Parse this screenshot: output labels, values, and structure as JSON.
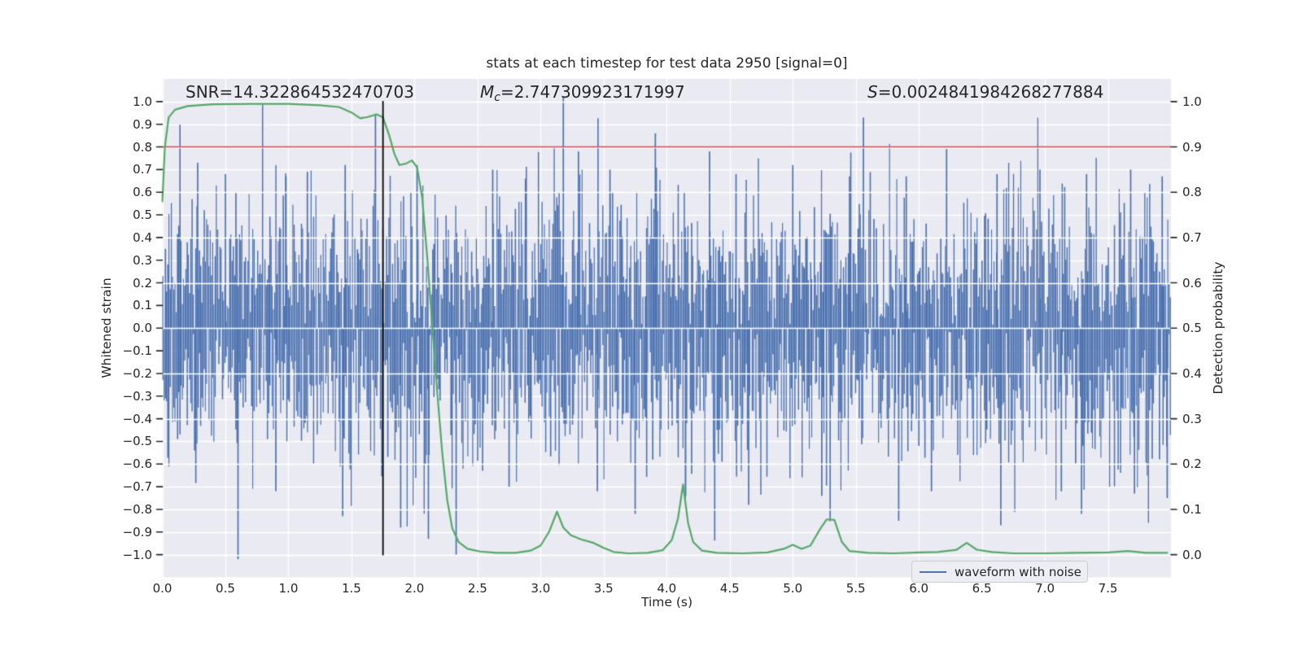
{
  "title": "stats at each timestep for test data 2950 [signal=0]",
  "annotations": {
    "snr": "SNR=14.322864532470703",
    "mc_var": "M",
    "mc_sub": "c",
    "mc_rest": "=2.747309923171997",
    "s_var": "S",
    "s_rest": "=0.0024841984268277884"
  },
  "axis_labels": {
    "x": "Time (s)",
    "y_left": "Whitened strain",
    "y_right": "Detection probability"
  },
  "ticks": {
    "x": [
      "0.0",
      "0.5",
      "1.0",
      "1.5",
      "2.0",
      "2.5",
      "3.0",
      "3.5",
      "4.0",
      "4.5",
      "5.0",
      "5.5",
      "6.0",
      "6.5",
      "7.0",
      "7.5"
    ],
    "left": [
      "1.0",
      "0.9",
      "0.8",
      "0.7",
      "0.6",
      "0.5",
      "0.4",
      "0.3",
      "0.2",
      "0.1",
      "0.0",
      "−0.1",
      "−0.2",
      "−0.3",
      "−0.4",
      "−0.5",
      "−0.6",
      "−0.7",
      "−0.8",
      "−0.9",
      "−1.0"
    ],
    "right": [
      "1.0",
      "0.9",
      "0.8",
      "0.7",
      "0.6",
      "0.5",
      "0.4",
      "0.3",
      "0.2",
      "0.1",
      "0.0"
    ]
  },
  "legend": {
    "items": [
      {
        "label": "waveform with noise",
        "color": "#4C72B0"
      }
    ]
  },
  "colors": {
    "figure_bg": "#ffffff",
    "plot_bg": "#eaeaf2",
    "grid": "#ffffff",
    "waveform": "#4C72B0",
    "detection": "#55A868",
    "threshold": "#C44E52",
    "event_line": "#000000",
    "text": "#262626",
    "tick": "#262626"
  },
  "chart_data": {
    "type": "line",
    "title": "stats at each timestep for test data 2950 [signal=0]",
    "xlabel": "Time (s)",
    "ylabel_left": "Whitened strain",
    "ylabel_right": "Detection probability",
    "xlim": [
      0,
      8
    ],
    "ylim_left": [
      -1.1,
      1.1
    ],
    "ylim_right": [
      -0.05,
      1.05
    ],
    "grid": true,
    "legend_position": "lower right",
    "stats": {
      "SNR": 14.322864532470703,
      "Mc": 2.747309923171997,
      "S": 0.0024841984268277884,
      "signal": 0
    },
    "threshold_line": {
      "axis": "right",
      "value": 0.9
    },
    "event_line": {
      "axis": "x",
      "value": 1.75,
      "span_left_axis": [
        -1.0,
        1.0
      ]
    },
    "detection_curve": {
      "name": "detection probability",
      "axis": "right",
      "color_key": "detection",
      "points": [
        [
          0.0,
          0.78
        ],
        [
          0.02,
          0.9
        ],
        [
          0.05,
          0.965
        ],
        [
          0.1,
          0.982
        ],
        [
          0.2,
          0.99
        ],
        [
          0.4,
          0.994
        ],
        [
          0.7,
          0.995
        ],
        [
          1.0,
          0.995
        ],
        [
          1.25,
          0.992
        ],
        [
          1.4,
          0.988
        ],
        [
          1.5,
          0.976
        ],
        [
          1.57,
          0.963
        ],
        [
          1.63,
          0.966
        ],
        [
          1.7,
          0.972
        ],
        [
          1.75,
          0.965
        ],
        [
          1.8,
          0.925
        ],
        [
          1.84,
          0.885
        ],
        [
          1.88,
          0.86
        ],
        [
          1.93,
          0.863
        ],
        [
          1.98,
          0.87
        ],
        [
          2.02,
          0.855
        ],
        [
          2.06,
          0.79
        ],
        [
          2.1,
          0.66
        ],
        [
          2.14,
          0.51
        ],
        [
          2.18,
          0.36
        ],
        [
          2.22,
          0.225
        ],
        [
          2.26,
          0.12
        ],
        [
          2.3,
          0.058
        ],
        [
          2.35,
          0.028
        ],
        [
          2.42,
          0.013
        ],
        [
          2.52,
          0.007
        ],
        [
          2.65,
          0.004
        ],
        [
          2.8,
          0.004
        ],
        [
          2.92,
          0.009
        ],
        [
          3.0,
          0.02
        ],
        [
          3.07,
          0.052
        ],
        [
          3.13,
          0.095
        ],
        [
          3.18,
          0.06
        ],
        [
          3.24,
          0.043
        ],
        [
          3.32,
          0.034
        ],
        [
          3.42,
          0.026
        ],
        [
          3.5,
          0.015
        ],
        [
          3.58,
          0.006
        ],
        [
          3.7,
          0.003
        ],
        [
          3.85,
          0.004
        ],
        [
          3.97,
          0.01
        ],
        [
          4.04,
          0.032
        ],
        [
          4.09,
          0.08
        ],
        [
          4.13,
          0.155
        ],
        [
          4.17,
          0.07
        ],
        [
          4.21,
          0.028
        ],
        [
          4.28,
          0.009
        ],
        [
          4.4,
          0.004
        ],
        [
          4.6,
          0.003
        ],
        [
          4.8,
          0.005
        ],
        [
          4.93,
          0.013
        ],
        [
          5.0,
          0.022
        ],
        [
          5.07,
          0.013
        ],
        [
          5.14,
          0.02
        ],
        [
          5.22,
          0.058
        ],
        [
          5.27,
          0.078
        ],
        [
          5.33,
          0.077
        ],
        [
          5.39,
          0.028
        ],
        [
          5.45,
          0.008
        ],
        [
          5.6,
          0.004
        ],
        [
          5.8,
          0.003
        ],
        [
          6.0,
          0.005
        ],
        [
          6.15,
          0.006
        ],
        [
          6.3,
          0.011
        ],
        [
          6.38,
          0.026
        ],
        [
          6.46,
          0.011
        ],
        [
          6.58,
          0.006
        ],
        [
          6.75,
          0.003
        ],
        [
          7.0,
          0.003
        ],
        [
          7.25,
          0.004
        ],
        [
          7.5,
          0.005
        ],
        [
          7.66,
          0.008
        ],
        [
          7.8,
          0.004
        ],
        [
          7.97,
          0.004
        ]
      ]
    },
    "waveform": {
      "name": "waveform with noise",
      "axis": "left",
      "color_key": "waveform",
      "noise": {
        "seed": 2950,
        "sigma": 0.27,
        "samples_per_column": 4,
        "columns": 830
      },
      "spikes_up": [
        [
          0.28,
          0.73
        ],
        [
          0.5,
          0.68
        ],
        [
          0.98,
          0.67
        ],
        [
          1.15,
          0.69
        ],
        [
          1.45,
          0.72
        ],
        [
          1.69,
          0.94
        ],
        [
          2.02,
          0.72
        ],
        [
          2.62,
          0.7
        ],
        [
          2.88,
          0.66
        ],
        [
          3.18,
          1.02
        ],
        [
          3.3,
          0.78
        ],
        [
          3.55,
          0.7
        ],
        [
          3.91,
          0.86
        ],
        [
          4.34,
          0.78
        ],
        [
          4.55,
          0.68
        ],
        [
          5.0,
          0.72
        ],
        [
          5.45,
          0.67
        ],
        [
          5.56,
          0.93
        ],
        [
          5.9,
          0.67
        ],
        [
          6.22,
          0.79
        ],
        [
          6.62,
          0.68
        ],
        [
          6.96,
          0.7
        ],
        [
          7.33,
          0.68
        ],
        [
          7.68,
          0.7
        ],
        [
          7.93,
          0.67
        ]
      ],
      "spikes_down": [
        [
          0.6,
          -1.02
        ],
        [
          0.9,
          -0.72
        ],
        [
          1.43,
          -0.83
        ],
        [
          1.89,
          -0.88
        ],
        [
          2.11,
          -0.93
        ],
        [
          2.33,
          -1.0
        ],
        [
          2.75,
          -0.7
        ],
        [
          3.45,
          -0.72
        ],
        [
          3.75,
          -0.82
        ],
        [
          4.15,
          -0.74
        ],
        [
          4.65,
          -0.78
        ],
        [
          5.23,
          -0.74
        ],
        [
          5.84,
          -0.85
        ],
        [
          6.1,
          -0.72
        ],
        [
          6.65,
          -0.87
        ],
        [
          7.13,
          -0.72
        ],
        [
          7.29,
          -0.82
        ],
        [
          7.71,
          -0.73
        ],
        [
          7.97,
          -0.75
        ]
      ]
    }
  }
}
